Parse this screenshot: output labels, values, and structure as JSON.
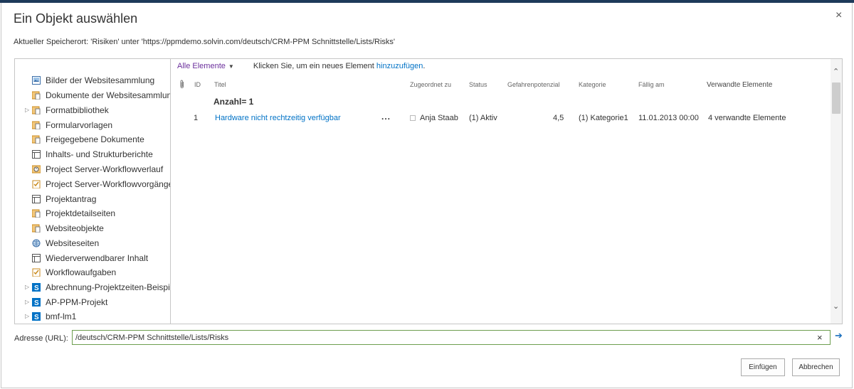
{
  "dialog": {
    "title": "Ein Objekt auswählen",
    "close_icon": "×",
    "location": "Aktueller Speicherort: 'Risiken' unter 'https://ppmdemo.solvin.com/deutsch/CRM-PPM Schnittstelle/Lists/Risks'"
  },
  "tree": {
    "items": [
      {
        "label": "Bilder der Websitesammlung",
        "icon": "picture-library-icon",
        "expandable": false
      },
      {
        "label": "Dokumente der Websitesammlung",
        "icon": "document-library-icon",
        "expandable": false
      },
      {
        "label": "Formatbibliothek",
        "icon": "document-library-icon",
        "expandable": true
      },
      {
        "label": "Formularvorlagen",
        "icon": "document-library-icon",
        "expandable": false
      },
      {
        "label": "Freigegebene Dokumente",
        "icon": "document-library-icon",
        "expandable": false
      },
      {
        "label": "Inhalts- und Strukturberichte",
        "icon": "list-icon",
        "expandable": false
      },
      {
        "label": "Project Server-Workflowverlauf",
        "icon": "workflow-history-icon",
        "expandable": false
      },
      {
        "label": "Project Server-Workflowvorgänge",
        "icon": "task-list-icon",
        "expandable": false
      },
      {
        "label": "Projektantrag",
        "icon": "list-icon",
        "expandable": false
      },
      {
        "label": "Projektdetailseiten",
        "icon": "document-library-icon",
        "expandable": false
      },
      {
        "label": "Websiteobjekte",
        "icon": "document-library-icon",
        "expandable": false
      },
      {
        "label": "Websiteseiten",
        "icon": "site-pages-icon",
        "expandable": false
      },
      {
        "label": "Wiederverwendbarer Inhalt",
        "icon": "list-icon",
        "expandable": false
      },
      {
        "label": "Workflowaufgaben",
        "icon": "task-list-icon",
        "expandable": false
      },
      {
        "label": "Abrechnung-Projektzeiten-Beispie",
        "icon": "sharepoint-site-icon",
        "expandable": true
      },
      {
        "label": "AP-PPM-Projekt",
        "icon": "sharepoint-site-icon",
        "expandable": true
      },
      {
        "label": "bmf-lm1",
        "icon": "sharepoint-site-icon",
        "expandable": true
      }
    ]
  },
  "list": {
    "view_selector": "Alle Elemente",
    "hint_prefix": "Klicken Sie, um ein neues Element",
    "hint_link": "hinzuzufügen",
    "hint_suffix": ".",
    "columns": {
      "attachment": "attachment-icon",
      "id": "ID",
      "title": "Titel",
      "assigned": "Zugeordnet zu",
      "status": "Status",
      "risk": "Gefahrenpotenzial",
      "category": "Kategorie",
      "due": "Fällig am",
      "related": "Verwandte Elemente"
    },
    "group_count": "Anzahl= 1",
    "rows": [
      {
        "id": "1",
        "title": "Hardware nicht rechtzeitig verfügbar",
        "menu": "...",
        "assigned": "Anja Staab",
        "status": "(1) Aktiv",
        "risk": "4,5",
        "category": "(1) Kategorie1",
        "due": "11.01.2013 00:00",
        "related": "4 verwandte Elemente"
      }
    ]
  },
  "scrollbar": {
    "up_icon": "⌃",
    "down_icon": "⌄",
    "position": 0
  },
  "address": {
    "label": "Adresse (URL):",
    "value": "/deutsch/CRM-PPM Schnittstelle/Lists/Risks",
    "clear_icon": "×",
    "go_icon": "➔"
  },
  "buttons": {
    "insert": "Einfügen",
    "cancel": "Abbrechen"
  },
  "colors": {
    "accent_link": "#0072c6",
    "view_selector": "#6b2f9c",
    "input_border": "#6d9e4f",
    "top_stripe": "#1e3a5a"
  }
}
